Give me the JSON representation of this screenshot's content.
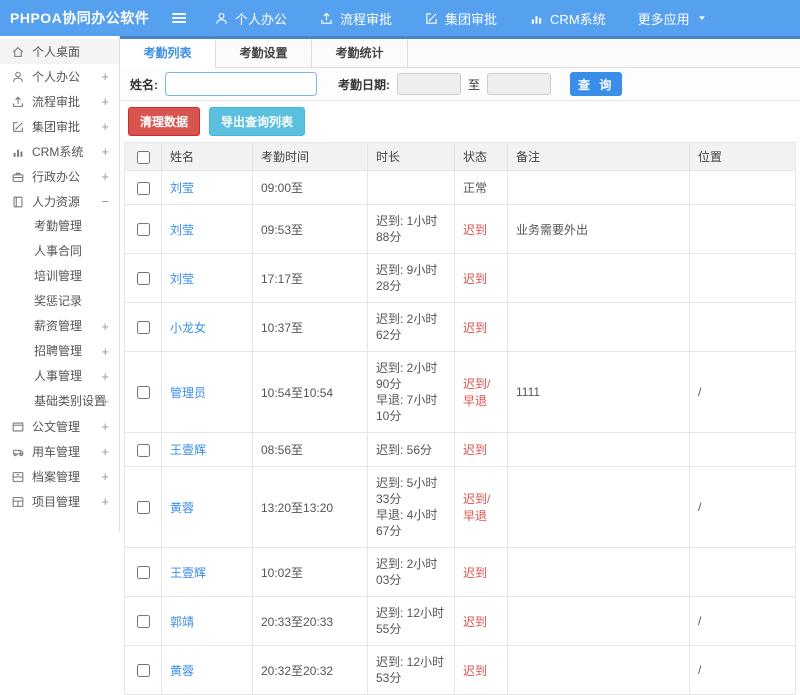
{
  "header": {
    "logo": "PHPOA协同办公软件",
    "nav": [
      {
        "label": "个人办公",
        "icon": "user"
      },
      {
        "label": "流程审批",
        "icon": "share"
      },
      {
        "label": "集团审批",
        "icon": "edit"
      },
      {
        "label": "CRM系统",
        "icon": "chart"
      },
      {
        "label": "更多应用",
        "icon": "",
        "caret": true
      }
    ]
  },
  "sidebar": {
    "items": [
      {
        "label": "个人桌面",
        "icon": "home",
        "expand": "",
        "current": true
      },
      {
        "label": "个人办公",
        "icon": "user",
        "expand": "+"
      },
      {
        "label": "流程审批",
        "icon": "share",
        "expand": "+"
      },
      {
        "label": "集团审批",
        "icon": "edit",
        "expand": "+"
      },
      {
        "label": "CRM系统",
        "icon": "chart",
        "expand": "+"
      },
      {
        "label": "行政办公",
        "icon": "briefcase",
        "expand": "+"
      },
      {
        "label": "人力资源",
        "icon": "hr",
        "expand": "−",
        "children": [
          {
            "label": "考勤管理",
            "expand": ""
          },
          {
            "label": "人事合同",
            "expand": ""
          },
          {
            "label": "培训管理",
            "expand": ""
          },
          {
            "label": "奖惩记录",
            "expand": ""
          },
          {
            "label": "薪资管理",
            "expand": "+"
          },
          {
            "label": "招聘管理",
            "expand": "+"
          },
          {
            "label": "人事管理",
            "expand": "+"
          },
          {
            "label": "基础类别设置",
            "expand": "+"
          }
        ]
      },
      {
        "label": "公文管理",
        "icon": "doc",
        "expand": "+"
      },
      {
        "label": "用车管理",
        "icon": "car",
        "expand": "+"
      },
      {
        "label": "档案管理",
        "icon": "archive",
        "expand": "+"
      },
      {
        "label": "项目管理",
        "icon": "project",
        "expand": "+"
      }
    ]
  },
  "tabs": [
    {
      "label": "考勤列表"
    },
    {
      "label": "考勤设置"
    },
    {
      "label": "考勤统计"
    }
  ],
  "active_tab": "考勤列表",
  "filter": {
    "name_label": "姓名:",
    "name_value": "",
    "date_label": "考勤日期:",
    "date_from": "",
    "to_label": "至",
    "date_to": "",
    "search_button": "查 询"
  },
  "toolbar": {
    "clean_button": "清理数据",
    "export_button": "导出查询列表"
  },
  "table": {
    "columns": [
      "姓名",
      "考勤时间",
      "时长",
      "状态",
      "备注",
      "位置"
    ],
    "rows": [
      {
        "name": "刘莹",
        "time": "09:00至",
        "duration": "",
        "status": "正常",
        "status_red": false,
        "note": "",
        "location": ""
      },
      {
        "name": "刘莹",
        "time": "09:53至",
        "duration": "迟到: 1小时88分",
        "status": "迟到",
        "status_red": true,
        "note": "业务需要外出",
        "location": ""
      },
      {
        "name": "刘莹",
        "time": "17:17至",
        "duration": "迟到: 9小时28分",
        "status": "迟到",
        "status_red": true,
        "note": "",
        "location": ""
      },
      {
        "name": "小龙女",
        "time": "10:37至",
        "duration": "迟到: 2小时62分",
        "status": "迟到",
        "status_red": true,
        "note": "",
        "location": ""
      },
      {
        "name": "管理员",
        "time": "10:54至10:54",
        "duration": "迟到: 2小时90分\n早退: 7小时10分",
        "status": "迟到/早退",
        "status_red": true,
        "note": "1111",
        "location": "/"
      },
      {
        "name": "王壹辉",
        "time": "08:56至",
        "duration": "迟到: 56分",
        "status": "迟到",
        "status_red": true,
        "note": "",
        "location": ""
      },
      {
        "name": "黄蓉",
        "time": "13:20至13:20",
        "duration": "迟到: 5小时33分\n早退: 4小时67分",
        "status": "迟到/早退",
        "status_red": true,
        "note": "",
        "location": "/"
      },
      {
        "name": "王壹辉",
        "time": "10:02至",
        "duration": "迟到: 2小时03分",
        "status": "迟到",
        "status_red": true,
        "note": "",
        "location": ""
      },
      {
        "name": "郭靖",
        "time": "20:33至20:33",
        "duration": "迟到: 12小时55分",
        "status": "迟到",
        "status_red": true,
        "note": "",
        "location": "/"
      },
      {
        "name": "黄蓉",
        "time": "20:32至20:32",
        "duration": "迟到: 12小时53分",
        "status": "迟到",
        "status_red": true,
        "note": "",
        "location": "/"
      }
    ]
  },
  "colors": {
    "header_blue": "#56a0f0",
    "accent_dark_blue": "#4486c9",
    "link_blue": "#3a8ee8",
    "danger_red": "#d9534f",
    "export_teal": "#5bc0de"
  }
}
